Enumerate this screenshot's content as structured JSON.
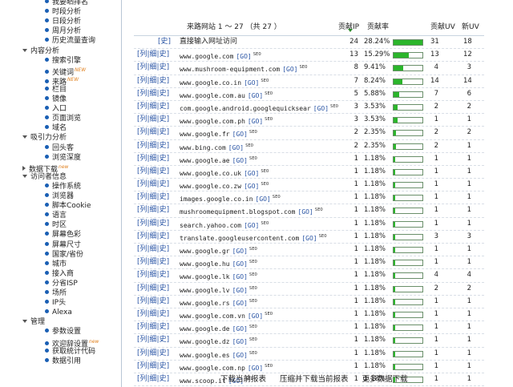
{
  "sidebar": {
    "items": [
      {
        "label": "我要晒排名",
        "level": "sub"
      },
      {
        "label": "时段分析",
        "level": "sub"
      },
      {
        "label": "日段分析",
        "level": "sub"
      },
      {
        "label": "周月分析",
        "level": "sub"
      },
      {
        "label": "历史流量查询",
        "level": "sub"
      },
      {
        "label": "内容分析",
        "level": "section",
        "expanded": true
      },
      {
        "label": "搜索引擎",
        "level": "sub"
      },
      {
        "label": "关键词",
        "level": "sub",
        "badge": "NEW"
      },
      {
        "label": "来路",
        "level": "sub",
        "badge": "NEW"
      },
      {
        "label": "栏目",
        "level": "sub"
      },
      {
        "label": "镜像",
        "level": "sub"
      },
      {
        "label": "入口",
        "level": "sub"
      },
      {
        "label": "页面浏览",
        "level": "sub"
      },
      {
        "label": "域名",
        "level": "sub"
      },
      {
        "label": "吸引力分析",
        "level": "section",
        "expanded": true
      },
      {
        "label": "回头客",
        "level": "sub"
      },
      {
        "label": "浏览深度",
        "level": "sub"
      },
      {
        "label": "数据下载",
        "level": "section",
        "expanded": false,
        "badge": "new"
      },
      {
        "label": "访问者信息",
        "level": "section",
        "expanded": true
      },
      {
        "label": "操作系统",
        "level": "sub"
      },
      {
        "label": "浏览器",
        "level": "sub"
      },
      {
        "label": "脚本Cookie",
        "level": "sub"
      },
      {
        "label": "语言",
        "level": "sub"
      },
      {
        "label": "时区",
        "level": "sub"
      },
      {
        "label": "屏幕色彩",
        "level": "sub"
      },
      {
        "label": "屏幕尺寸",
        "level": "sub"
      },
      {
        "label": "国家/省份",
        "level": "sub"
      },
      {
        "label": "城市",
        "level": "sub"
      },
      {
        "label": "接入商",
        "level": "sub"
      },
      {
        "label": "分省ISP",
        "level": "sub"
      },
      {
        "label": "场所",
        "level": "sub"
      },
      {
        "label": "IP头",
        "level": "sub"
      },
      {
        "label": "Alexa",
        "level": "sub"
      },
      {
        "label": "管理",
        "level": "section",
        "expanded": true
      },
      {
        "label": "参数设置",
        "level": "sub"
      },
      {
        "label": "欢迎辞设置",
        "level": "sub",
        "badge": "new"
      },
      {
        "label": "获取统计代码",
        "level": "sub"
      },
      {
        "label": "数据引用",
        "level": "sub"
      }
    ]
  },
  "table": {
    "header": {
      "title": "来路网站 1 ～ 27 （共 27 ）",
      "ip": "贡献IP",
      "rate": "贡献率",
      "uv": "贡献UV",
      "new_uv": "新UV"
    },
    "links_label": "[列|细|史]",
    "direct_label": "[史]",
    "go_label": "[GO]",
    "seo_label": "SEO",
    "rows": [
      {
        "site": "直接输入网址访问",
        "direct": true,
        "ip": "24",
        "rate": "28.24%",
        "pct": 28.24,
        "uv": "31",
        "new_uv": "18"
      },
      {
        "site": "www.google.com",
        "ip": "13",
        "rate": "15.29%",
        "pct": 15.29,
        "uv": "13",
        "new_uv": "12"
      },
      {
        "site": "www.mushroom-equipment.com",
        "ip": "8",
        "rate": "9.41%",
        "pct": 9.41,
        "uv": "4",
        "new_uv": "3"
      },
      {
        "site": "www.google.co.in",
        "ip": "7",
        "rate": "8.24%",
        "pct": 8.24,
        "uv": "14",
        "new_uv": "14"
      },
      {
        "site": "www.google.com.au",
        "ip": "5",
        "rate": "5.88%",
        "pct": 5.88,
        "uv": "7",
        "new_uv": "6"
      },
      {
        "site": "com.google.android.googlequicksear",
        "ip": "3",
        "rate": "3.53%",
        "pct": 3.53,
        "uv": "2",
        "new_uv": "2"
      },
      {
        "site": "www.google.com.ph",
        "ip": "3",
        "rate": "3.53%",
        "pct": 3.53,
        "uv": "1",
        "new_uv": "1"
      },
      {
        "site": "www.google.fr",
        "ip": "2",
        "rate": "2.35%",
        "pct": 2.35,
        "uv": "2",
        "new_uv": "2"
      },
      {
        "site": "www.bing.com",
        "ip": "2",
        "rate": "2.35%",
        "pct": 2.35,
        "uv": "2",
        "new_uv": "1"
      },
      {
        "site": "www.google.ae",
        "ip": "1",
        "rate": "1.18%",
        "pct": 1.18,
        "uv": "1",
        "new_uv": "1"
      },
      {
        "site": "www.google.co.uk",
        "ip": "1",
        "rate": "1.18%",
        "pct": 1.18,
        "uv": "1",
        "new_uv": "1"
      },
      {
        "site": "www.google.co.zw",
        "ip": "1",
        "rate": "1.18%",
        "pct": 1.18,
        "uv": "1",
        "new_uv": "1"
      },
      {
        "site": "images.google.co.in",
        "ip": "1",
        "rate": "1.18%",
        "pct": 1.18,
        "uv": "1",
        "new_uv": "1"
      },
      {
        "site": "mushroomequipment.blogspot.com",
        "ip": "1",
        "rate": "1.18%",
        "pct": 1.18,
        "uv": "1",
        "new_uv": "1"
      },
      {
        "site": "search.yahoo.com",
        "ip": "1",
        "rate": "1.18%",
        "pct": 1.18,
        "uv": "1",
        "new_uv": "1"
      },
      {
        "site": "translate.googleusercontent.com",
        "ip": "1",
        "rate": "1.18%",
        "pct": 1.18,
        "uv": "3",
        "new_uv": "3"
      },
      {
        "site": "www.google.gr",
        "ip": "1",
        "rate": "1.18%",
        "pct": 1.18,
        "uv": "1",
        "new_uv": "1"
      },
      {
        "site": "www.google.hu",
        "ip": "1",
        "rate": "1.18%",
        "pct": 1.18,
        "uv": "1",
        "new_uv": "1"
      },
      {
        "site": "www.google.lk",
        "ip": "1",
        "rate": "1.18%",
        "pct": 1.18,
        "uv": "4",
        "new_uv": "4"
      },
      {
        "site": "www.google.lv",
        "ip": "1",
        "rate": "1.18%",
        "pct": 1.18,
        "uv": "2",
        "new_uv": "2"
      },
      {
        "site": "www.google.rs",
        "ip": "1",
        "rate": "1.18%",
        "pct": 1.18,
        "uv": "1",
        "new_uv": "1"
      },
      {
        "site": "www.google.com.vn",
        "ip": "1",
        "rate": "1.18%",
        "pct": 1.18,
        "uv": "1",
        "new_uv": "1"
      },
      {
        "site": "www.google.de",
        "ip": "1",
        "rate": "1.18%",
        "pct": 1.18,
        "uv": "1",
        "new_uv": "1"
      },
      {
        "site": "www.google.dz",
        "ip": "1",
        "rate": "1.18%",
        "pct": 1.18,
        "uv": "1",
        "new_uv": "1"
      },
      {
        "site": "www.google.es",
        "ip": "1",
        "rate": "1.18%",
        "pct": 1.18,
        "uv": "1",
        "new_uv": "1"
      },
      {
        "site": "www.google.com.np",
        "ip": "1",
        "rate": "1.18%",
        "pct": 1.18,
        "uv": "1",
        "new_uv": "1"
      },
      {
        "site": "www.scoop.it",
        "ip": "1",
        "rate": "1.18%",
        "pct": 1.18,
        "uv": "1",
        "new_uv": "1"
      }
    ]
  },
  "footer": {
    "download_current": "下载当前报表",
    "zip_download": "压缩并下载当前报表",
    "more_downloads": "更多数据下载"
  },
  "colors": {
    "bar_fill": "#2bb52b",
    "link": "#2a55a5",
    "sort_icon": "#2a8a2a"
  }
}
